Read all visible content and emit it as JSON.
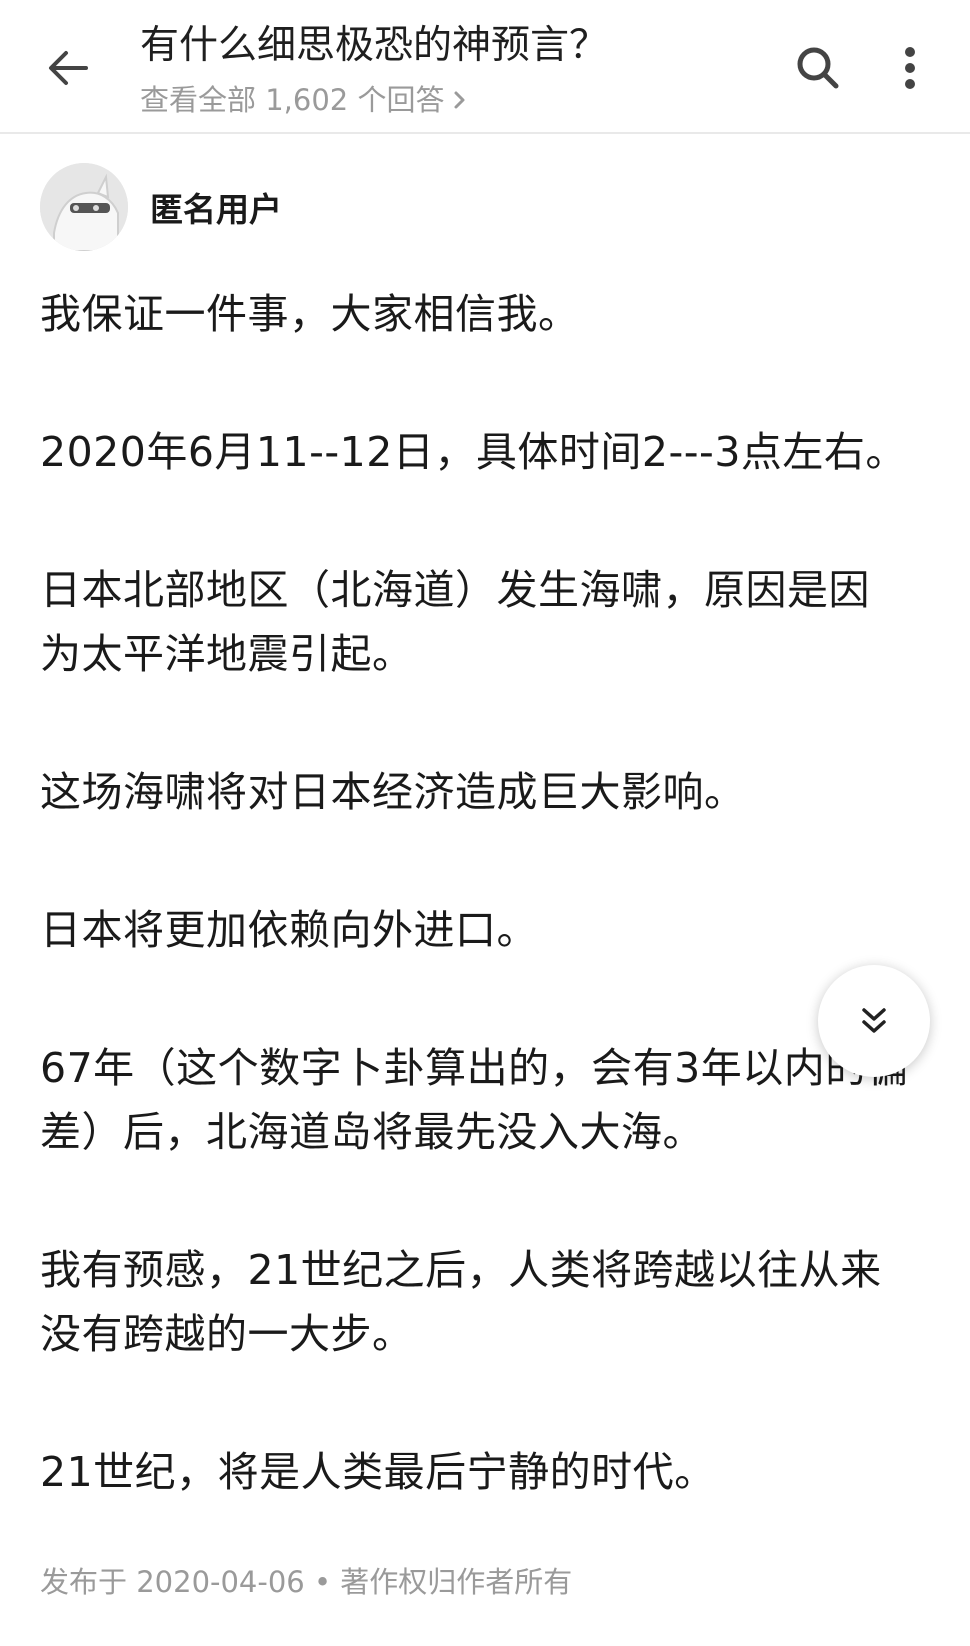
{
  "header": {
    "title": "有什么细思极恐的神预言？",
    "subtitle": "查看全部 1,602 个回答",
    "back_icon": "arrow-left-icon",
    "search_icon": "search-icon",
    "more_icon": "more-vertical-icon"
  },
  "author": {
    "name": "匿名用户",
    "avatar_icon": "anonymous-avatar-icon"
  },
  "answer": {
    "paragraphs": [
      "我保证一件事，大家相信我。",
      "2020年6月11--12日，具体时间2---3点左右。",
      "日本北部地区（北海道）发生海啸，原因是因为太平洋地震引起。",
      "这场海啸将对日本经济造成巨大影响。",
      "日本将更加依赖向外进口。",
      "67年（这个数字卜卦算出的，会有3年以内的偏差）后，北海道岛将最先没入大海。",
      "我有预感，21世纪之后，人类将跨越以往从来没有跨越的一大步。",
      "21世纪，将是人类最后宁静的时代。"
    ],
    "meta": "发布于 2020-04-06 • 著作权归作者所有"
  },
  "fab": {
    "icon": "double-chevron-down-icon"
  },
  "colors": {
    "text": "#1a1a1a",
    "muted": "#9a9a9a",
    "divider": "#e9e9e9"
  }
}
